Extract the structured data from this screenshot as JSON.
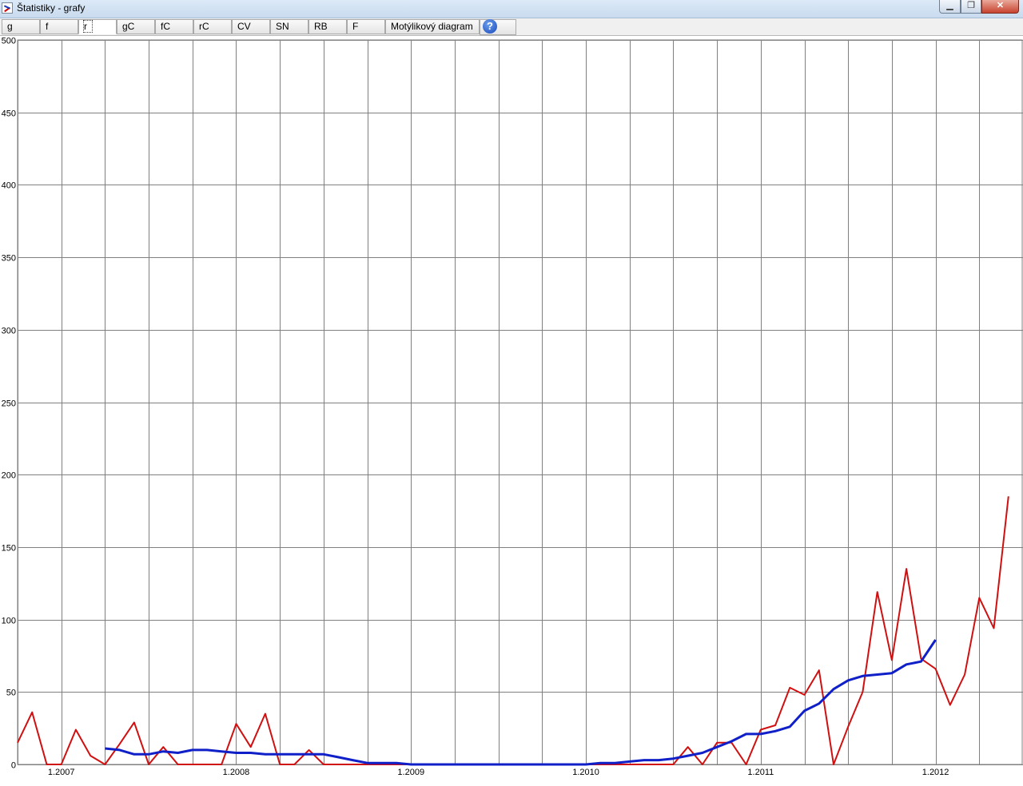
{
  "window": {
    "title": "Štatistiky - grafy",
    "controls": {
      "minimize": "▁",
      "maximize": "❐",
      "close": "✕"
    }
  },
  "tabs": [
    {
      "label": "g"
    },
    {
      "label": "f"
    },
    {
      "label": "r",
      "active": true
    },
    {
      "label": "gC"
    },
    {
      "label": "fC"
    },
    {
      "label": "rC"
    },
    {
      "label": "CV"
    },
    {
      "label": "SN"
    },
    {
      "label": "RB"
    },
    {
      "label": "F"
    },
    {
      "label": "Motýlikový diagram"
    }
  ],
  "help_icon": "question-icon",
  "help_glyph": "?",
  "chart_data": {
    "type": "line",
    "ylim": [
      0,
      500
    ],
    "yticks": [
      0,
      50,
      100,
      150,
      200,
      250,
      300,
      350,
      400,
      450,
      500
    ],
    "xlim": [
      "2006-10",
      "2012-07"
    ],
    "xtick_labels": [
      "1.2007",
      "1.2008",
      "1.2009",
      "1.2010",
      "1.2011",
      "1.2012"
    ],
    "grid": true,
    "series": [
      {
        "color": "#d01010",
        "points": [
          [
            "2006-10",
            15
          ],
          [
            "2006-11",
            36
          ],
          [
            "2006-12",
            0
          ],
          [
            "2007-01",
            0
          ],
          [
            "2007-02",
            24
          ],
          [
            "2007-03",
            6
          ],
          [
            "2007-04",
            0
          ],
          [
            "2007-05",
            14
          ],
          [
            "2007-06",
            29
          ],
          [
            "2007-07",
            0
          ],
          [
            "2007-08",
            12
          ],
          [
            "2007-09",
            0
          ],
          [
            "2007-10",
            0
          ],
          [
            "2007-11",
            0
          ],
          [
            "2007-12",
            0
          ],
          [
            "2008-01",
            28
          ],
          [
            "2008-02",
            12
          ],
          [
            "2008-03",
            35
          ],
          [
            "2008-04",
            0
          ],
          [
            "2008-05",
            0
          ],
          [
            "2008-06",
            10
          ],
          [
            "2008-07",
            0
          ],
          [
            "2008-08",
            0
          ],
          [
            "2008-09",
            0
          ],
          [
            "2008-10",
            0
          ],
          [
            "2008-11",
            0
          ],
          [
            "2008-12",
            0
          ],
          [
            "2009-01",
            0
          ],
          [
            "2009-02",
            0
          ],
          [
            "2009-03",
            0
          ],
          [
            "2009-04",
            0
          ],
          [
            "2009-05",
            0
          ],
          [
            "2009-06",
            0
          ],
          [
            "2009-07",
            0
          ],
          [
            "2009-08",
            0
          ],
          [
            "2009-09",
            0
          ],
          [
            "2009-10",
            0
          ],
          [
            "2009-11",
            0
          ],
          [
            "2009-12",
            0
          ],
          [
            "2010-01",
            0
          ],
          [
            "2010-02",
            0
          ],
          [
            "2010-03",
            0
          ],
          [
            "2010-04",
            0
          ],
          [
            "2010-05",
            0
          ],
          [
            "2010-06",
            0
          ],
          [
            "2010-07",
            0
          ],
          [
            "2010-08",
            12
          ],
          [
            "2010-09",
            0
          ],
          [
            "2010-10",
            15
          ],
          [
            "2010-11",
            15
          ],
          [
            "2010-12",
            0
          ],
          [
            "2011-01",
            24
          ],
          [
            "2011-02",
            27
          ],
          [
            "2011-03",
            53
          ],
          [
            "2011-04",
            48
          ],
          [
            "2011-05",
            65
          ],
          [
            "2011-06",
            0
          ],
          [
            "2011-07",
            26
          ],
          [
            "2011-08",
            50
          ],
          [
            "2011-09",
            119
          ],
          [
            "2011-10",
            72
          ],
          [
            "2011-11",
            135
          ],
          [
            "2011-12",
            73
          ],
          [
            "2012-01",
            66
          ],
          [
            "2012-02",
            41
          ],
          [
            "2012-03",
            62
          ],
          [
            "2012-04",
            115
          ],
          [
            "2012-05",
            94
          ],
          [
            "2012-06",
            185
          ]
        ]
      },
      {
        "color": "#1020c8",
        "points": [
          [
            "2007-04",
            11
          ],
          [
            "2007-05",
            10
          ],
          [
            "2007-06",
            7
          ],
          [
            "2007-07",
            7
          ],
          [
            "2007-08",
            9
          ],
          [
            "2007-09",
            8
          ],
          [
            "2007-10",
            10
          ],
          [
            "2007-11",
            10
          ],
          [
            "2007-12",
            9
          ],
          [
            "2008-01",
            8
          ],
          [
            "2008-02",
            8
          ],
          [
            "2008-03",
            7
          ],
          [
            "2008-04",
            7
          ],
          [
            "2008-05",
            7
          ],
          [
            "2008-06",
            7
          ],
          [
            "2008-07",
            7
          ],
          [
            "2008-08",
            5
          ],
          [
            "2008-09",
            3
          ],
          [
            "2008-10",
            1
          ],
          [
            "2008-11",
            1
          ],
          [
            "2008-12",
            1
          ],
          [
            "2009-01",
            0
          ],
          [
            "2009-02",
            0
          ],
          [
            "2009-03",
            0
          ],
          [
            "2009-04",
            0
          ],
          [
            "2009-05",
            0
          ],
          [
            "2009-06",
            0
          ],
          [
            "2009-07",
            0
          ],
          [
            "2009-08",
            0
          ],
          [
            "2009-09",
            0
          ],
          [
            "2009-10",
            0
          ],
          [
            "2009-11",
            0
          ],
          [
            "2009-12",
            0
          ],
          [
            "2010-01",
            0
          ],
          [
            "2010-02",
            1
          ],
          [
            "2010-03",
            1
          ],
          [
            "2010-04",
            2
          ],
          [
            "2010-05",
            3
          ],
          [
            "2010-06",
            3
          ],
          [
            "2010-07",
            4
          ],
          [
            "2010-08",
            6
          ],
          [
            "2010-09",
            8
          ],
          [
            "2010-10",
            12
          ],
          [
            "2010-11",
            16
          ],
          [
            "2010-12",
            21
          ],
          [
            "2011-01",
            21
          ],
          [
            "2011-02",
            23
          ],
          [
            "2011-03",
            26
          ],
          [
            "2011-04",
            37
          ],
          [
            "2011-05",
            42
          ],
          [
            "2011-06",
            52
          ],
          [
            "2011-07",
            58
          ],
          [
            "2011-08",
            61
          ],
          [
            "2011-09",
            62
          ],
          [
            "2011-10",
            63
          ],
          [
            "2011-11",
            69
          ],
          [
            "2011-12",
            71
          ],
          [
            "2012-01",
            86
          ]
        ]
      }
    ]
  }
}
